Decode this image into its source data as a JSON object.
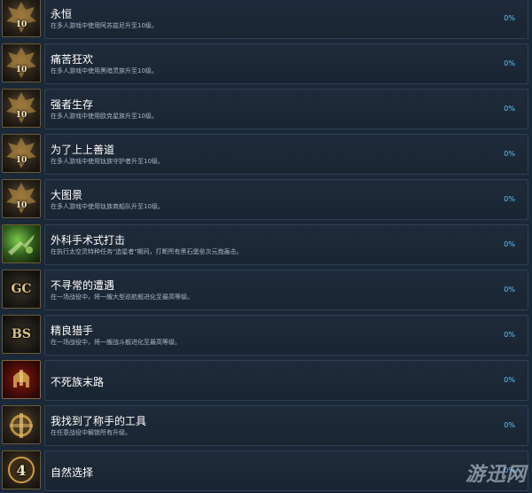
{
  "achievements": [
    {
      "icon": "winged-shield-emblem-icon",
      "badge": "10",
      "title": "永恒",
      "desc": "在多人游戏中使用阿苏兹尼升至10级。",
      "pct": "0%"
    },
    {
      "icon": "winged-shield-emblem-icon",
      "badge": "10",
      "title": "痛苦狂欢",
      "desc": "在多人游戏中使用黑暗灵族升至10级。",
      "pct": "0%"
    },
    {
      "icon": "winged-shield-emblem-icon",
      "badge": "10",
      "title": "强者生存",
      "desc": "在多人游戏中使用欧克星族升至10级。",
      "pct": "0%"
    },
    {
      "icon": "winged-shield-emblem-icon",
      "badge": "10",
      "title": "为了上上善道",
      "desc": "在多人游戏中使用钛族守护者升至10级。",
      "pct": "0%"
    },
    {
      "icon": "winged-shield-emblem-icon",
      "badge": "10",
      "title": "大图景",
      "desc": "在多人游戏中使用钛族商船队升至10级。",
      "pct": "0%"
    },
    {
      "icon": "space-battle-icon",
      "badge": "",
      "title": "外科手术式打击",
      "desc": "在执行太空灵特种任务\"追星者\"期间，打断所有黑石堡垒次元炮轰击。",
      "pct": "0%"
    },
    {
      "icon": "gc-monogram-icon",
      "badge": "GC",
      "title": "不寻常的遭遇",
      "desc": "在一场战役中，将一艘大型巡航舰进化至最高等级。",
      "pct": "0%"
    },
    {
      "icon": "bs-monogram-icon",
      "badge": "BS",
      "title": "精良猎手",
      "desc": "在一场战役中，将一艘战斗舰进化至最高等级。",
      "pct": "0%"
    },
    {
      "icon": "helmet-icon",
      "badge": "",
      "title": "不死族末路",
      "desc": "",
      "pct": "0%"
    },
    {
      "icon": "tools-emblem-icon",
      "badge": "",
      "title": "我找到了称手的工具",
      "desc": "在任意战役中解锁所有升级。",
      "pct": "0%"
    },
    {
      "icon": "number-four-emblem-icon",
      "badge": "4",
      "title": "自然选择",
      "desc": "",
      "pct": "0%"
    }
  ],
  "watermark": "游迅网",
  "colors": {
    "background": "#1b2838",
    "panel": "#1f2b3a",
    "panel_border": "#2f4055",
    "percent": "#67c1f5",
    "icon_frame": "#6e5a33"
  }
}
